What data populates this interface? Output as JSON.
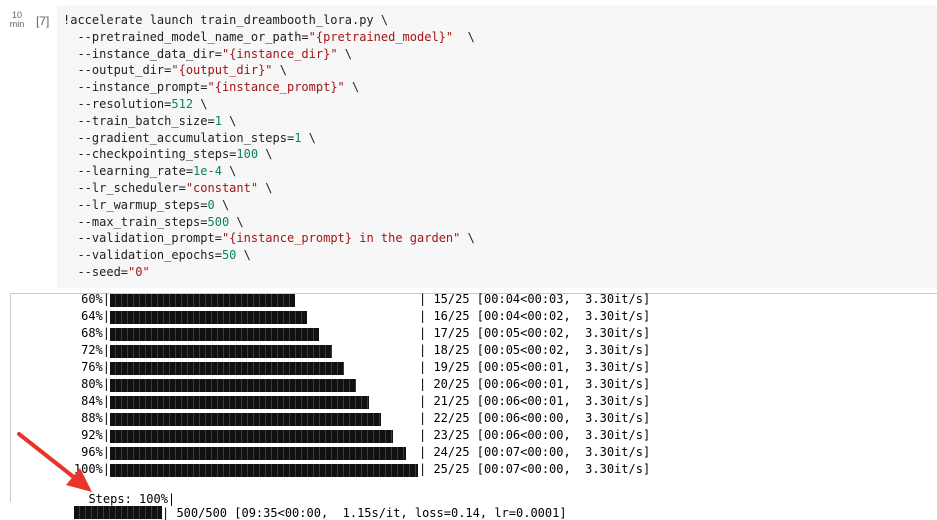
{
  "cell": {
    "exec_time_value": "10",
    "exec_time_unit": "min",
    "exec_count": "[7]",
    "code_lines": [
      [
        {
          "t": "kw",
          "v": "!accelerate launch train_dreambooth_lora.py \\"
        }
      ],
      [
        {
          "t": "plain",
          "v": "  --pretrained_model_name_or_path="
        },
        {
          "t": "str",
          "v": "\"{pretrained_model}\""
        },
        {
          "t": "plain",
          "v": "  \\"
        }
      ],
      [
        {
          "t": "plain",
          "v": "  --instance_data_dir="
        },
        {
          "t": "str",
          "v": "\"{instance_dir}\""
        },
        {
          "t": "plain",
          "v": " \\"
        }
      ],
      [
        {
          "t": "plain",
          "v": "  --output_dir="
        },
        {
          "t": "str",
          "v": "\"{output_dir}\""
        },
        {
          "t": "plain",
          "v": " \\"
        }
      ],
      [
        {
          "t": "plain",
          "v": "  --instance_prompt="
        },
        {
          "t": "str",
          "v": "\"{instance_prompt}\""
        },
        {
          "t": "plain",
          "v": " \\"
        }
      ],
      [
        {
          "t": "plain",
          "v": "  --resolution="
        },
        {
          "t": "num",
          "v": "512"
        },
        {
          "t": "plain",
          "v": " \\"
        }
      ],
      [
        {
          "t": "plain",
          "v": "  --train_batch_size="
        },
        {
          "t": "num",
          "v": "1"
        },
        {
          "t": "plain",
          "v": " \\"
        }
      ],
      [
        {
          "t": "plain",
          "v": "  --gradient_accumulation_steps="
        },
        {
          "t": "num",
          "v": "1"
        },
        {
          "t": "plain",
          "v": " \\"
        }
      ],
      [
        {
          "t": "plain",
          "v": "  --checkpointing_steps="
        },
        {
          "t": "num",
          "v": "100"
        },
        {
          "t": "plain",
          "v": " \\"
        }
      ],
      [
        {
          "t": "plain",
          "v": "  --learning_rate="
        },
        {
          "t": "num",
          "v": "1e-4"
        },
        {
          "t": "plain",
          "v": " \\"
        }
      ],
      [
        {
          "t": "plain",
          "v": "  --lr_scheduler="
        },
        {
          "t": "str",
          "v": "\"constant\""
        },
        {
          "t": "plain",
          "v": " \\"
        }
      ],
      [
        {
          "t": "plain",
          "v": "  --lr_warmup_steps="
        },
        {
          "t": "num",
          "v": "0"
        },
        {
          "t": "plain",
          "v": " \\"
        }
      ],
      [
        {
          "t": "plain",
          "v": "  --max_train_steps="
        },
        {
          "t": "num",
          "v": "500"
        },
        {
          "t": "plain",
          "v": " \\"
        }
      ],
      [
        {
          "t": "plain",
          "v": "  --validation_prompt="
        },
        {
          "t": "str",
          "v": "\"{instance_prompt} in the garden\""
        },
        {
          "t": "plain",
          "v": " \\"
        }
      ],
      [
        {
          "t": "plain",
          "v": "  --validation_epochs="
        },
        {
          "t": "num",
          "v": "50"
        },
        {
          "t": "plain",
          "v": " \\"
        }
      ],
      [
        {
          "t": "plain",
          "v": "  --seed="
        },
        {
          "t": "str",
          "v": "\"0\""
        }
      ]
    ]
  },
  "output": {
    "progress_rows": [
      {
        "pct": "60%|",
        "fraction": 0.6,
        "stats": "| 15/25 [00:04<00:03,  3.30it/s]"
      },
      {
        "pct": "64%|",
        "fraction": 0.64,
        "stats": "| 16/25 [00:04<00:02,  3.30it/s]"
      },
      {
        "pct": "68%|",
        "fraction": 0.68,
        "stats": "| 17/25 [00:05<00:02,  3.30it/s]"
      },
      {
        "pct": "72%|",
        "fraction": 0.72,
        "stats": "| 18/25 [00:05<00:02,  3.30it/s]"
      },
      {
        "pct": "76%|",
        "fraction": 0.76,
        "stats": "| 19/25 [00:05<00:01,  3.30it/s]"
      },
      {
        "pct": "80%|",
        "fraction": 0.8,
        "stats": "| 20/25 [00:06<00:01,  3.30it/s]"
      },
      {
        "pct": "84%|",
        "fraction": 0.84,
        "stats": "| 21/25 [00:06<00:01,  3.30it/s]"
      },
      {
        "pct": "88%|",
        "fraction": 0.88,
        "stats": "| 22/25 [00:06<00:00,  3.30it/s]"
      },
      {
        "pct": "92%|",
        "fraction": 0.92,
        "stats": "| 23/25 [00:06<00:00,  3.30it/s]"
      },
      {
        "pct": "96%|",
        "fraction": 0.96,
        "stats": "| 24/25 [00:07<00:00,  3.30it/s]"
      },
      {
        "pct": "100%|",
        "fraction": 1.0,
        "stats": "| 25/25 [00:07<00:00,  3.30it/s]"
      }
    ],
    "steps_row": {
      "label": "Steps: 100%|",
      "fraction": 1.0,
      "stats": "| 500/500 [09:35<00:00,  1.15s/it, loss=0.14, lr=0.0001]"
    }
  },
  "colors": {
    "arrow": "#e8342a",
    "string": "#a31515",
    "number": "#098658"
  },
  "icons": {
    "annotation": "red-arrow-icon"
  }
}
